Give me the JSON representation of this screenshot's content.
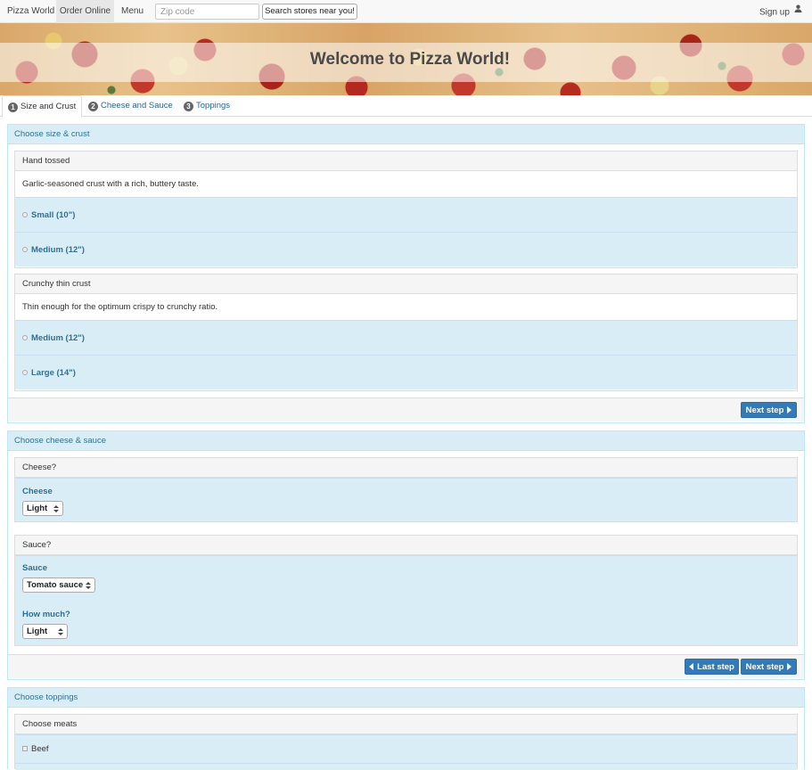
{
  "nav": {
    "brand": "Pizza World",
    "links": [
      "Order Online",
      "Menu"
    ],
    "zip_placeholder": "Zip code",
    "search_button": "Search stores near you!",
    "signup": "Sign up"
  },
  "banner": {
    "title": "Welcome to Pizza World!"
  },
  "tabs": [
    {
      "num": "1",
      "label": "Size and Crust"
    },
    {
      "num": "2",
      "label": "Cheese and Sauce"
    },
    {
      "num": "3",
      "label": "Toppings"
    }
  ],
  "size_crust": {
    "heading": "Choose size & crust",
    "crusts": [
      {
        "name": "Hand tossed",
        "description": "Garlic-seasoned crust with a rich, buttery taste.",
        "sizes": [
          "Small (10\")",
          "Medium (12\")"
        ]
      },
      {
        "name": "Crunchy thin crust",
        "description": "Thin enough for the optimum crispy to crunchy ratio.",
        "sizes": [
          "Medium (12\")",
          "Large (14\")"
        ]
      }
    ],
    "next_button": "Next step"
  },
  "cheese_sauce": {
    "heading": "Choose cheese & sauce",
    "cheese": {
      "title": "Cheese?",
      "label": "Cheese",
      "value": "Light"
    },
    "sauce": {
      "title": "Sauce?",
      "label": "Sauce",
      "value": "Tomato sauce",
      "amount_label": "How much?",
      "amount_value": "Light"
    },
    "last_button": "Last step",
    "next_button": "Next step"
  },
  "toppings": {
    "heading": "Choose toppings",
    "meats_title": "Choose meats",
    "meats": [
      "Beef"
    ]
  }
}
